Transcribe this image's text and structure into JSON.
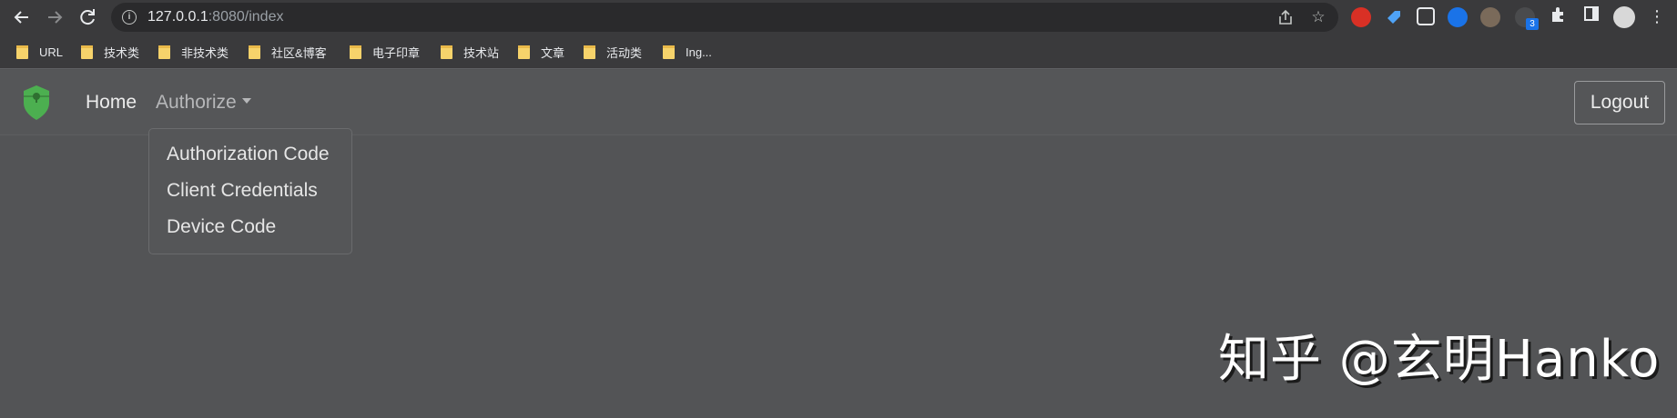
{
  "browser": {
    "url_host": "127.0.0.1",
    "url_rest": ":8080/index",
    "bookmarks": [
      "URL",
      "技术类",
      "非技术类",
      "社区&博客",
      "电子印章",
      "技术站",
      "文章",
      "活动类",
      "Ing..."
    ],
    "extension_badge": "3",
    "icons": {
      "back": "arrow-left-icon",
      "forward": "arrow-right-icon",
      "reload": "reload-icon",
      "info": "info-icon",
      "share": "share-icon",
      "star": "star-icon"
    }
  },
  "navbar": {
    "brand_icon": "shield-icon",
    "home_label": "Home",
    "authorize_label": "Authorize",
    "logout_label": "Logout",
    "brand_color": "#4caf50"
  },
  "dropdown": {
    "items": [
      "Authorization Code",
      "Client Credentials",
      "Device Code"
    ]
  },
  "watermark": {
    "text": "知乎 @玄明Hanko"
  }
}
